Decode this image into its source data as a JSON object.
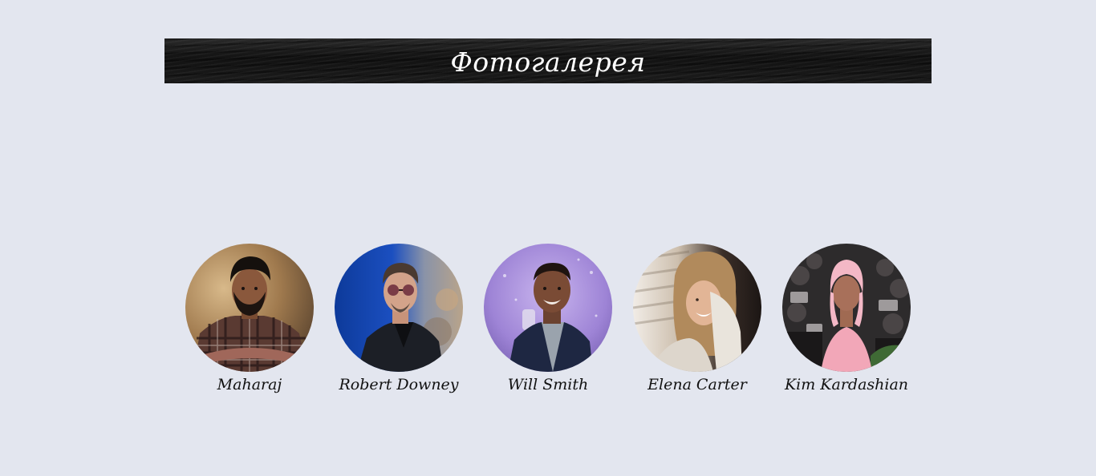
{
  "header": {
    "title": "Фотогалерея"
  },
  "gallery": {
    "people": [
      {
        "name": "Maharaj",
        "photo_icon": "person-photo-maharaj"
      },
      {
        "name": "Robert Downey",
        "photo_icon": "person-photo-robert-downey"
      },
      {
        "name": "Will Smith",
        "photo_icon": "person-photo-will-smith"
      },
      {
        "name": "Elena Carter",
        "photo_icon": "person-photo-elena-carter"
      },
      {
        "name": "Kim Kardashian",
        "photo_icon": "person-photo-kim-kardashian"
      }
    ]
  },
  "colors": {
    "page_background": "#e3e6ef",
    "banner_background": "#161616",
    "banner_text": "#ffffff",
    "caption_text": "#111111"
  }
}
